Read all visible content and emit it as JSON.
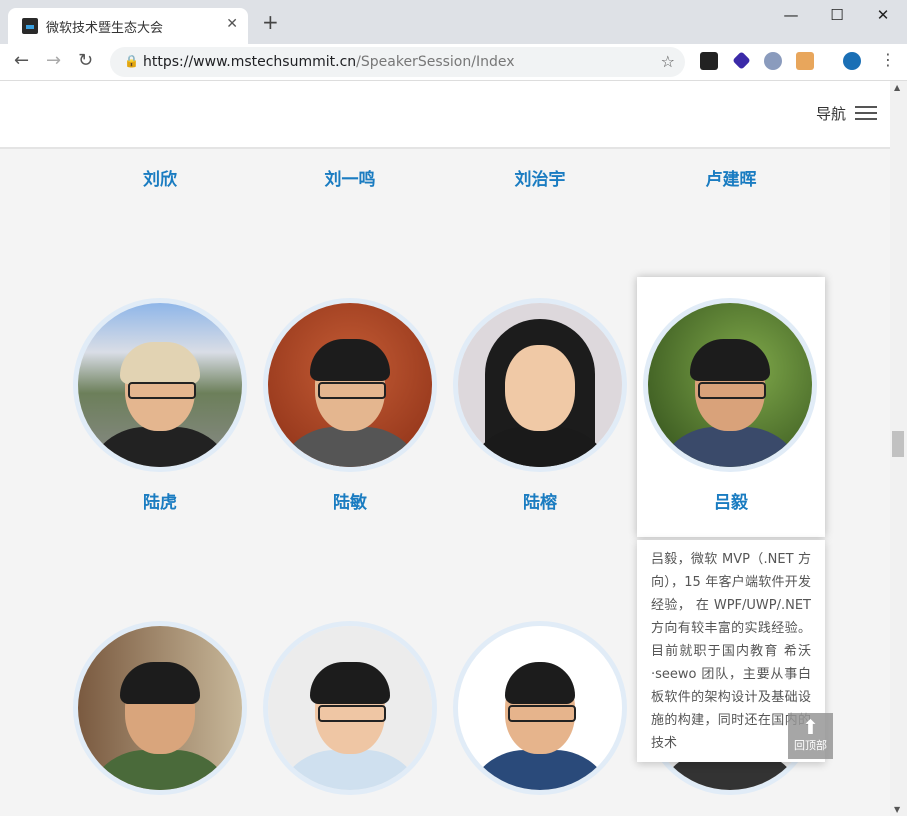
{
  "browser": {
    "tab_title": "微软技术暨生态大会",
    "tab_close": "✕",
    "new_tab": "+",
    "url_domain": "https://www.mstechsummit.cn",
    "url_path": "/SpeakerSession/Index",
    "window_buttons": [
      "—",
      "☐",
      "✕"
    ]
  },
  "site": {
    "nav_label": "导航"
  },
  "speakers_row1": [
    "刘欣",
    "刘一鸣",
    "刘治宇",
    "卢建晖"
  ],
  "speakers_row2": [
    "陆虎",
    "陆敏",
    "陆榕",
    "吕毅"
  ],
  "speakers_row3": [
    "",
    "",
    "",
    ""
  ],
  "bio": {
    "text": "吕毅，微软 MVP（.NET 方向），15 年客户端软件开发经验， 在 WPF/UWP/.NET 方向有较丰富的实践经验。目前就职于国内教育 希沃·seewo 团队，主要从事白板软件的架构设计及基础设施的构建，同时还在国内的技术"
  },
  "back_to_top": {
    "label": "回顶部"
  },
  "colors": {
    "accent": "#1a7cc1",
    "ring": "#e1ecf7"
  }
}
